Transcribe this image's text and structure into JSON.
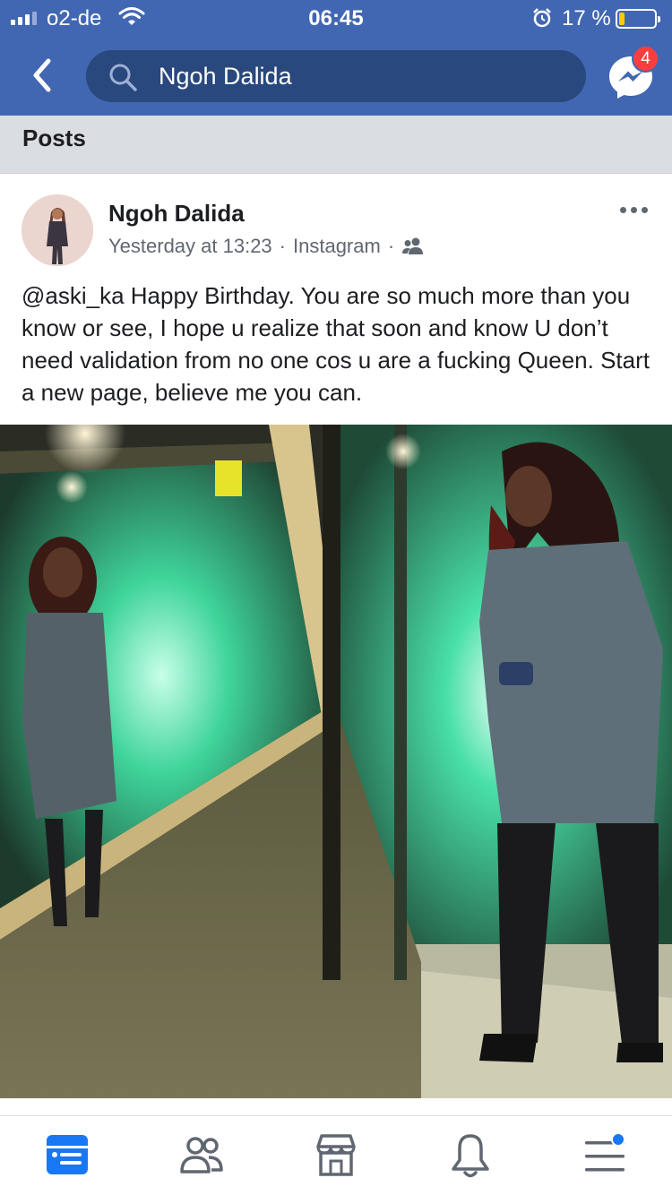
{
  "status_bar": {
    "carrier": "o2-de",
    "time": "06:45",
    "battery_percent": "17 %",
    "battery_level": 0.17,
    "battery_color": "#ffcc00"
  },
  "nav": {
    "back_icon": "chevron-left-icon",
    "search_icon": "search-icon",
    "search_text": "Ngoh Dalida",
    "messenger_icon": "messenger-icon",
    "messenger_badge": "4"
  },
  "section": {
    "label": "Posts"
  },
  "post": {
    "author": "Ngoh Dalida",
    "time": "Yesterday at 13:23",
    "source": "Instagram",
    "separator": "·",
    "audience_icon": "friends-icon",
    "text": "@aski_ka Happy Birthday. You are so much more than you know or see, I hope u realize that soon and know U don’t need validation from no one cos u are a fucking Queen. Start a new page, believe me you can.",
    "more_icon": "more-options-icon"
  },
  "tab_bar": [
    {
      "name": "news-feed",
      "icon": "news-feed-icon",
      "active": true
    },
    {
      "name": "friends",
      "icon": "friends-icon",
      "active": false
    },
    {
      "name": "marketplace",
      "icon": "marketplace-icon",
      "active": false
    },
    {
      "name": "notifications",
      "icon": "bell-icon",
      "active": false
    },
    {
      "name": "menu",
      "icon": "menu-icon",
      "active": false
    }
  ],
  "colors": {
    "header": "#4267b2",
    "search_field": "#29487d",
    "badge": "#fa3e3e",
    "active_tab": "#1877f2",
    "inactive_tab": "#606770"
  }
}
